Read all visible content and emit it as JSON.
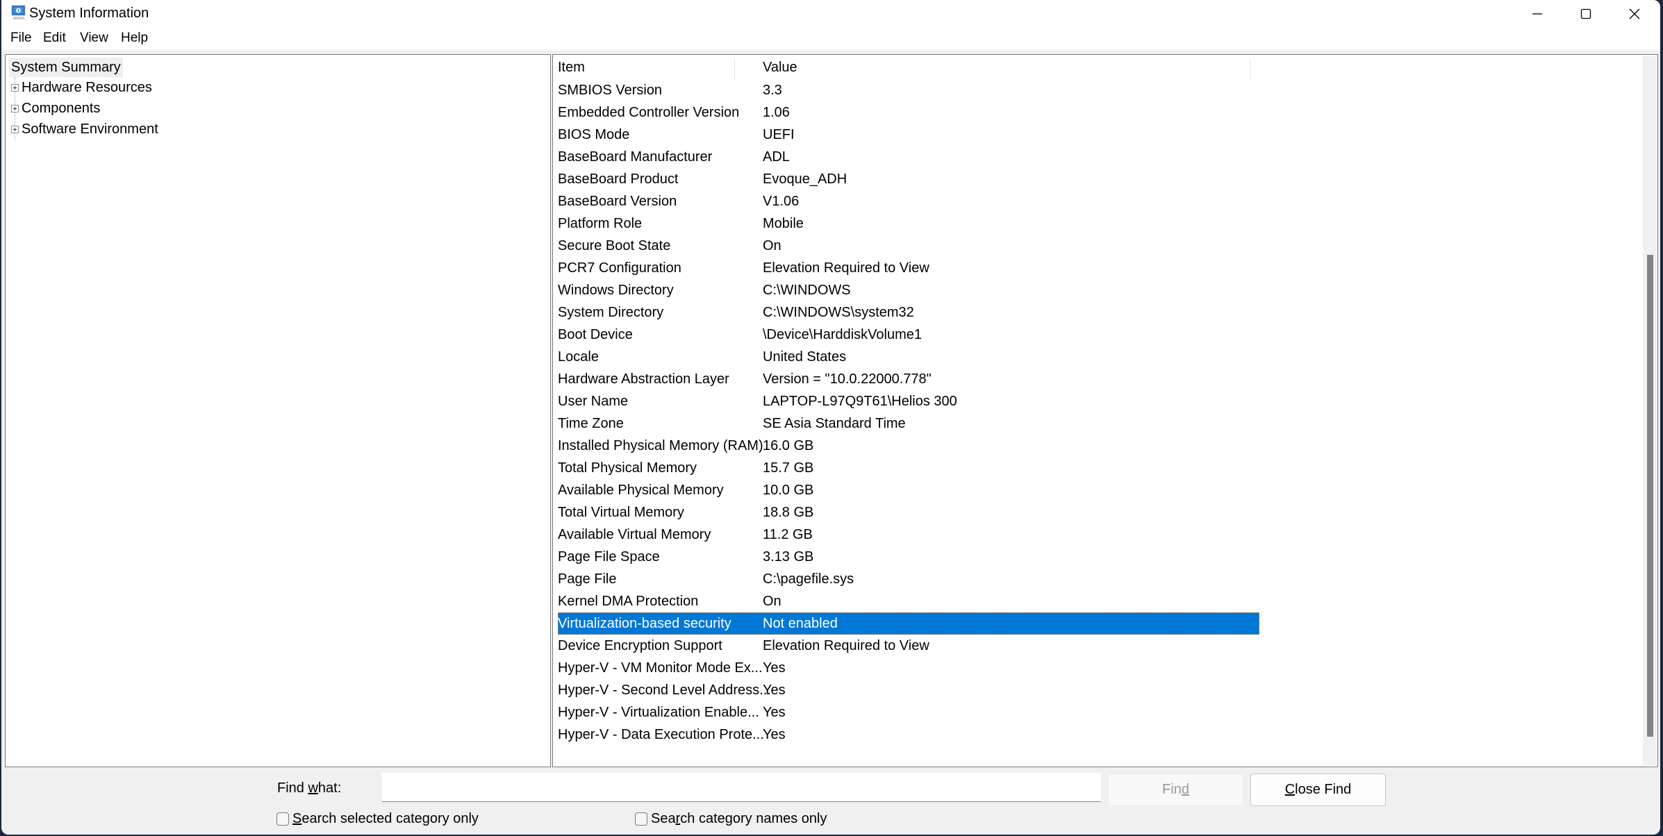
{
  "window": {
    "title": "System Information",
    "icon": "system-information-icon",
    "controls": {
      "minimize": "minimize-icon",
      "maximize": "maximize-icon",
      "close": "close-icon"
    }
  },
  "menu": {
    "items": [
      {
        "label": "File"
      },
      {
        "label": "Edit"
      },
      {
        "label": "View"
      },
      {
        "label": "Help"
      }
    ]
  },
  "tree": {
    "root": "System Summary",
    "nodes": [
      {
        "label": "Hardware Resources",
        "expanded": false
      },
      {
        "label": "Components",
        "expanded": false
      },
      {
        "label": "Software Environment",
        "expanded": false
      }
    ]
  },
  "list": {
    "columns": [
      "Item",
      "Value"
    ],
    "rows": [
      {
        "item": "SMBIOS Version",
        "value": "3.3"
      },
      {
        "item": "Embedded Controller Version",
        "value": "1.06"
      },
      {
        "item": "BIOS Mode",
        "value": "UEFI"
      },
      {
        "item": "BaseBoard Manufacturer",
        "value": "ADL"
      },
      {
        "item": "BaseBoard Product",
        "value": "Evoque_ADH"
      },
      {
        "item": "BaseBoard Version",
        "value": "V1.06"
      },
      {
        "item": "Platform Role",
        "value": "Mobile"
      },
      {
        "item": "Secure Boot State",
        "value": "On"
      },
      {
        "item": "PCR7 Configuration",
        "value": "Elevation Required to View"
      },
      {
        "item": "Windows Directory",
        "value": "C:\\WINDOWS"
      },
      {
        "item": "System Directory",
        "value": "C:\\WINDOWS\\system32"
      },
      {
        "item": "Boot Device",
        "value": "\\Device\\HarddiskVolume1"
      },
      {
        "item": "Locale",
        "value": "United States"
      },
      {
        "item": "Hardware Abstraction Layer",
        "value": "Version = \"10.0.22000.778\""
      },
      {
        "item": "User Name",
        "value": "LAPTOP-L97Q9T61\\Helios 300"
      },
      {
        "item": "Time Zone",
        "value": "SE Asia Standard Time"
      },
      {
        "item": "Installed Physical Memory (RAM)",
        "value": "16.0 GB"
      },
      {
        "item": "Total Physical Memory",
        "value": "15.7 GB"
      },
      {
        "item": "Available Physical Memory",
        "value": "10.0 GB"
      },
      {
        "item": "Total Virtual Memory",
        "value": "18.8 GB"
      },
      {
        "item": "Available Virtual Memory",
        "value": "11.2 GB"
      },
      {
        "item": "Page File Space",
        "value": "3.13 GB"
      },
      {
        "item": "Page File",
        "value": "C:\\pagefile.sys"
      },
      {
        "item": "Kernel DMA Protection",
        "value": "On"
      },
      {
        "item": "Virtualization-based security",
        "value": "Not enabled",
        "selected": true
      },
      {
        "item": "Device Encryption Support",
        "value": "Elevation Required to View"
      },
      {
        "item": "Hyper-V - VM Monitor Mode Ex...",
        "value": "Yes"
      },
      {
        "item": "Hyper-V - Second Level Address...",
        "value": "Yes"
      },
      {
        "item": "Hyper-V - Virtualization Enable...",
        "value": "Yes"
      },
      {
        "item": "Hyper-V - Data Execution Prote...",
        "value": "Yes"
      }
    ],
    "scroll": {
      "thumb_start_fraction": 0.28,
      "thumb_end_fraction": 0.96
    }
  },
  "find": {
    "label_pre": "Find ",
    "label_u": "w",
    "label_post": "hat:",
    "value": "",
    "find_pre": "Fin",
    "find_u": "d",
    "find_post": "",
    "close_u": "C",
    "close_post": "lose Find",
    "chk1_u": "S",
    "chk1_post": "earch selected category only",
    "chk1_checked": false,
    "chk2_pre": "Sea",
    "chk2_u": "r",
    "chk2_post": "ch category names only",
    "chk2_checked": false
  },
  "colors": {
    "selection": "#0078d7"
  }
}
